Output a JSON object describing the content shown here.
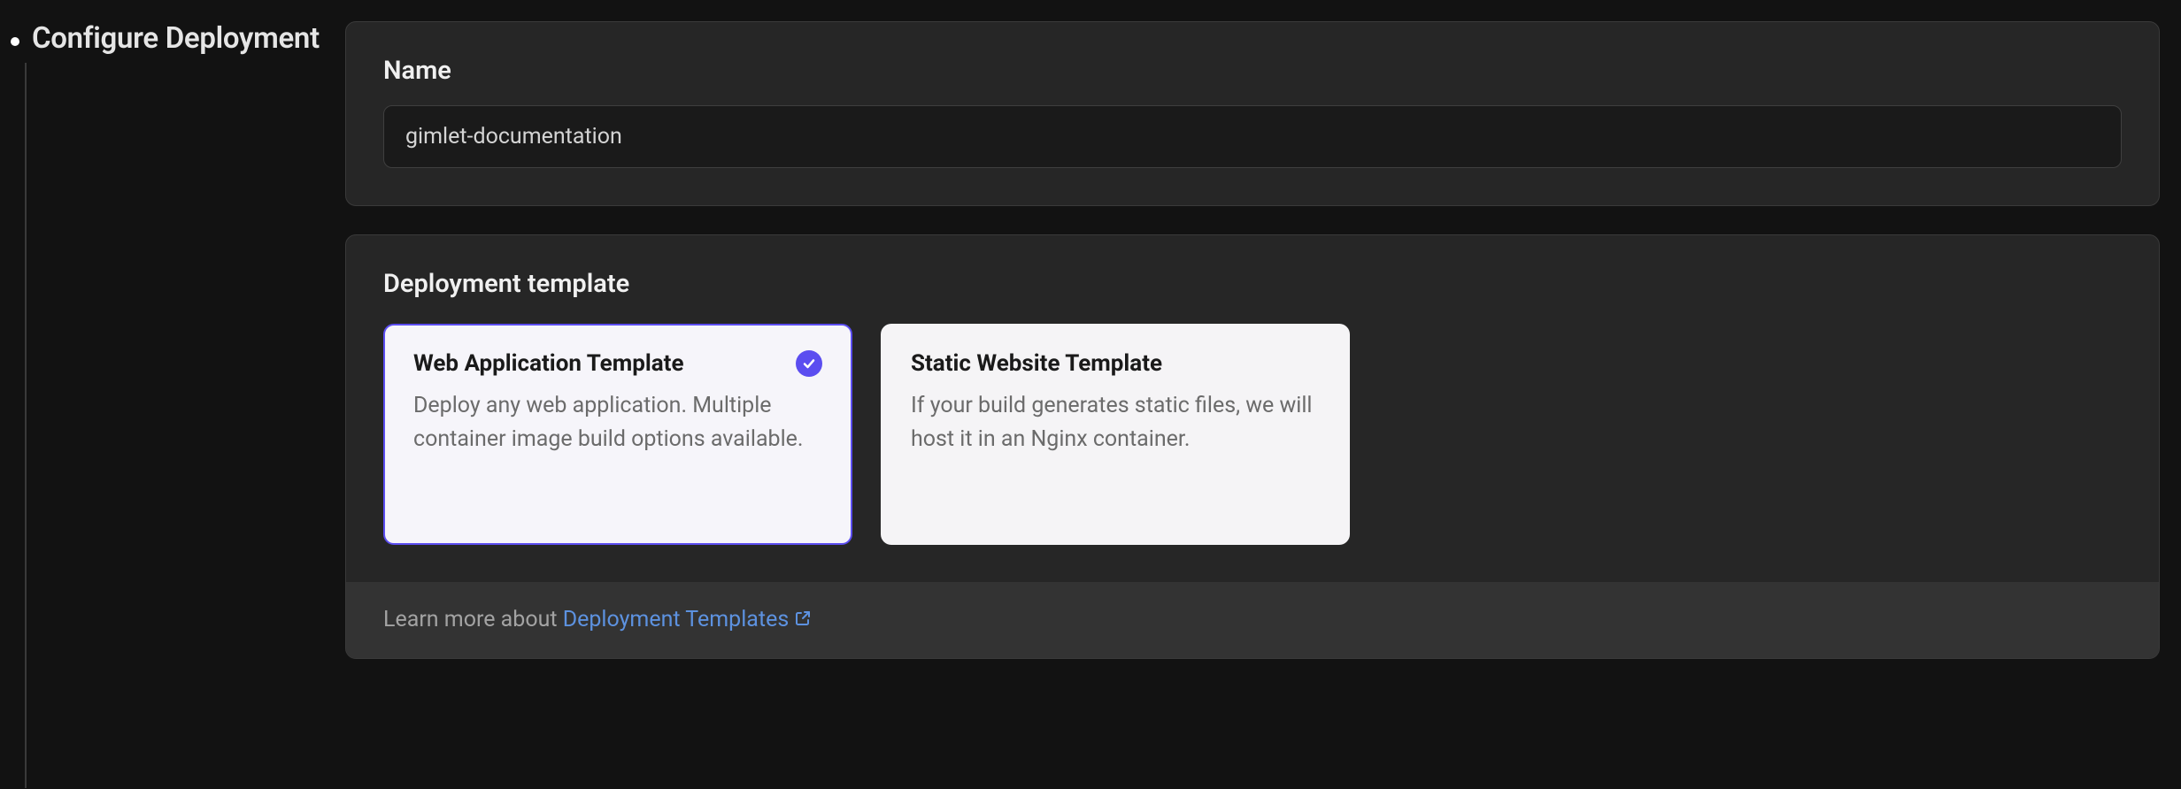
{
  "sidebar": {
    "step_title": "Configure Deployment"
  },
  "name_panel": {
    "label": "Name",
    "value": "gimlet-documentation"
  },
  "template_panel": {
    "title": "Deployment template",
    "templates": [
      {
        "title": "Web Application Template",
        "description": "Deploy any web application. Multiple container image build options available.",
        "selected": true
      },
      {
        "title": "Static Website Template",
        "description": "If your build generates static files, we will host it in an Nginx container.",
        "selected": false
      }
    ],
    "learn_more_prefix": "Learn more about ",
    "learn_more_link_text": "Deployment Templates"
  }
}
